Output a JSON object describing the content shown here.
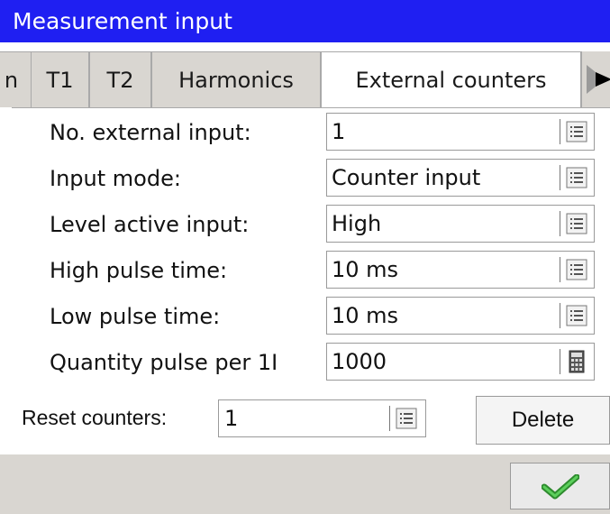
{
  "window": {
    "title": "Measurement input"
  },
  "tabs": [
    {
      "label": "n",
      "active": false
    },
    {
      "label": "T1",
      "active": false
    },
    {
      "label": "T2",
      "active": false
    },
    {
      "label": "Harmonics",
      "active": false
    },
    {
      "label": "External counters",
      "active": true
    }
  ],
  "form": {
    "rows": [
      {
        "label": "No. external input:",
        "value": "1",
        "icon": "list-icon"
      },
      {
        "label": "Input mode:",
        "value": "Counter input",
        "icon": "list-icon"
      },
      {
        "label": "Level active input:",
        "value": "High",
        "icon": "list-icon"
      },
      {
        "label": "High pulse time:",
        "value": "10 ms",
        "icon": "list-icon"
      },
      {
        "label": "Low pulse time:",
        "value": "10 ms",
        "icon": "list-icon"
      },
      {
        "label": "Quantity pulse per 1I",
        "value": "1000",
        "icon": "calculator-icon"
      }
    ]
  },
  "reset": {
    "label": "Reset counters:",
    "value": "1",
    "icon": "list-icon"
  },
  "buttons": {
    "delete": "Delete",
    "ok_icon": "checkmark-icon"
  },
  "colors": {
    "titlebar": "#1f1ff2",
    "panel_bg": "#d9d6d1",
    "check": "#3cb33c"
  }
}
